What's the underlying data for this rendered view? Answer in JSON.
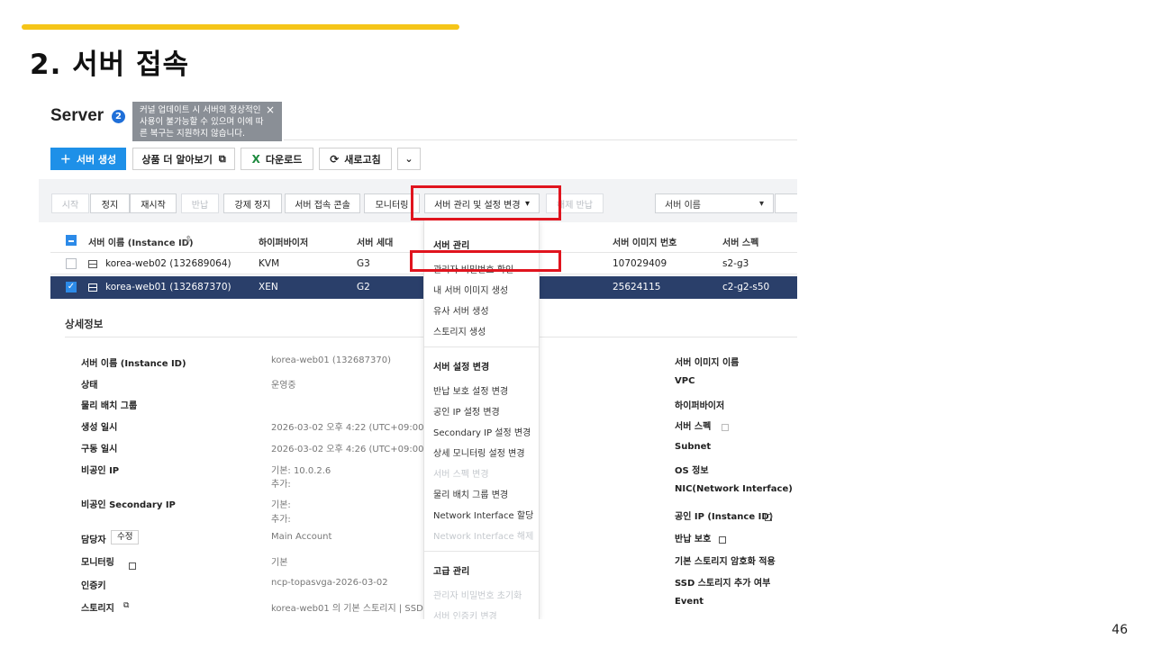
{
  "slide": {
    "title": "2. 서버 접속",
    "page_number": "46",
    "accent_color": "#f5c518"
  },
  "header": {
    "title": "Server",
    "help_badge": "2",
    "tooltip": "커널 업데이트 시 서버의 정상적인 사용이 불가능할 수 있으며 이에 따른 복구는 지원하지 않습니다.",
    "tooltip_close": "×"
  },
  "top_buttons": {
    "create": "서버 생성",
    "learn_more": "상품 더 알아보기",
    "download": "다운로드",
    "refresh": "새로고침"
  },
  "toolbar": {
    "start": "시작",
    "stop": "정지",
    "restart": "재시작",
    "return": "반납",
    "force_stop": "강제 정지",
    "console": "서버 접속 콘솔",
    "monitoring": "모니터링",
    "manage": "서버 관리 및 설정 변경",
    "release_return": "해제 반납",
    "search_select": "서버 이름"
  },
  "table": {
    "headers": {
      "name": "서버 이름 (Instance ID)",
      "hypervisor": "하이퍼바이저",
      "generation": "서버 세대",
      "image_no": "서버 이미지 번호",
      "spec": "서버 스펙"
    },
    "rows": [
      {
        "name": "korea-web02 (132689064)",
        "hypervisor": "KVM",
        "generation": "G3",
        "image_no": "107029409",
        "spec": "s2-g3"
      },
      {
        "name": "korea-web01 (132687370)",
        "hypervisor": "XEN",
        "generation": "G2",
        "image_no": "25624115",
        "spec": "c2-g2-s50"
      }
    ]
  },
  "details": {
    "title": "상세정보",
    "left": [
      {
        "label": "서버 이름 (Instance ID)",
        "value": "korea-web01 (132687370)"
      },
      {
        "label": "상태",
        "value": "운영중"
      },
      {
        "label": "물리 배치 그룹",
        "value": ""
      },
      {
        "label": "생성 일시",
        "value": "2026-03-02 오후 4:22 (UTC+09:00)"
      },
      {
        "label": "구동 일시",
        "value": "2026-03-02 오후 4:26 (UTC+09:00)"
      },
      {
        "label": "비공인 IP",
        "value": "기본: 10.0.2.6",
        "value2": "추가:"
      },
      {
        "label": "비공인 Secondary IP",
        "value": "기본:",
        "value2": "추가:"
      },
      {
        "label": "담당자",
        "value": "Main Account",
        "button": "수정"
      },
      {
        "label": "모니터링",
        "value": "기본"
      },
      {
        "label": "인증키",
        "value": "ncp-topasvga-2026-03-02"
      },
      {
        "label": "스토리지",
        "value": "korea-web01 의 기본 스토리지 | SSD | 50"
      }
    ],
    "right": [
      "서버 이미지 이름",
      "VPC",
      "하이퍼바이저",
      "서버 스펙",
      "Subnet",
      "OS 정보",
      "NIC(Network Interface)",
      "공인 IP (Instance ID)",
      "반납 보호",
      "기본 스토리지 암호화 적용",
      "SSD 스토리지 추가 여부",
      "Event"
    ]
  },
  "menu": {
    "section1": "서버 관리",
    "items1": [
      "관리자 비밀번호 확인",
      "내 서버 이미지 생성",
      "유사 서버 생성",
      "스토리지 생성"
    ],
    "section2": "서버 설정 변경",
    "items2": [
      "반납 보호 설정 변경",
      "공인 IP 설정 변경",
      "Secondary IP 설정 변경",
      "상세 모니터링 설정 변경",
      "서버 스펙 변경",
      "물리 배치 그룹 변경",
      "Network Interface 할당",
      "Network Interface 해제"
    ],
    "section3": "고급 관리",
    "items3": [
      "관리자 비밀번호 초기화",
      "서버 인증키 변경"
    ]
  }
}
